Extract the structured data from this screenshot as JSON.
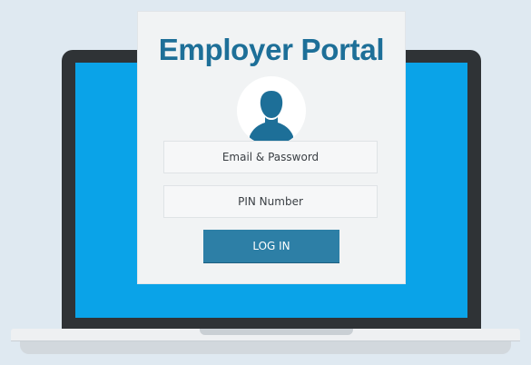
{
  "portal": {
    "title": "Employer Portal",
    "email_field": "Email & Password",
    "pin_field": "PIN Number",
    "login_button": "LOG IN",
    "avatar_icon": "user-silhouette-icon"
  },
  "colors": {
    "background": "#dfe9f1",
    "screen": "#0aa3e8",
    "title": "#1d6f98",
    "button": "#2d7fa6",
    "laptop_frame": "#2f3336"
  }
}
